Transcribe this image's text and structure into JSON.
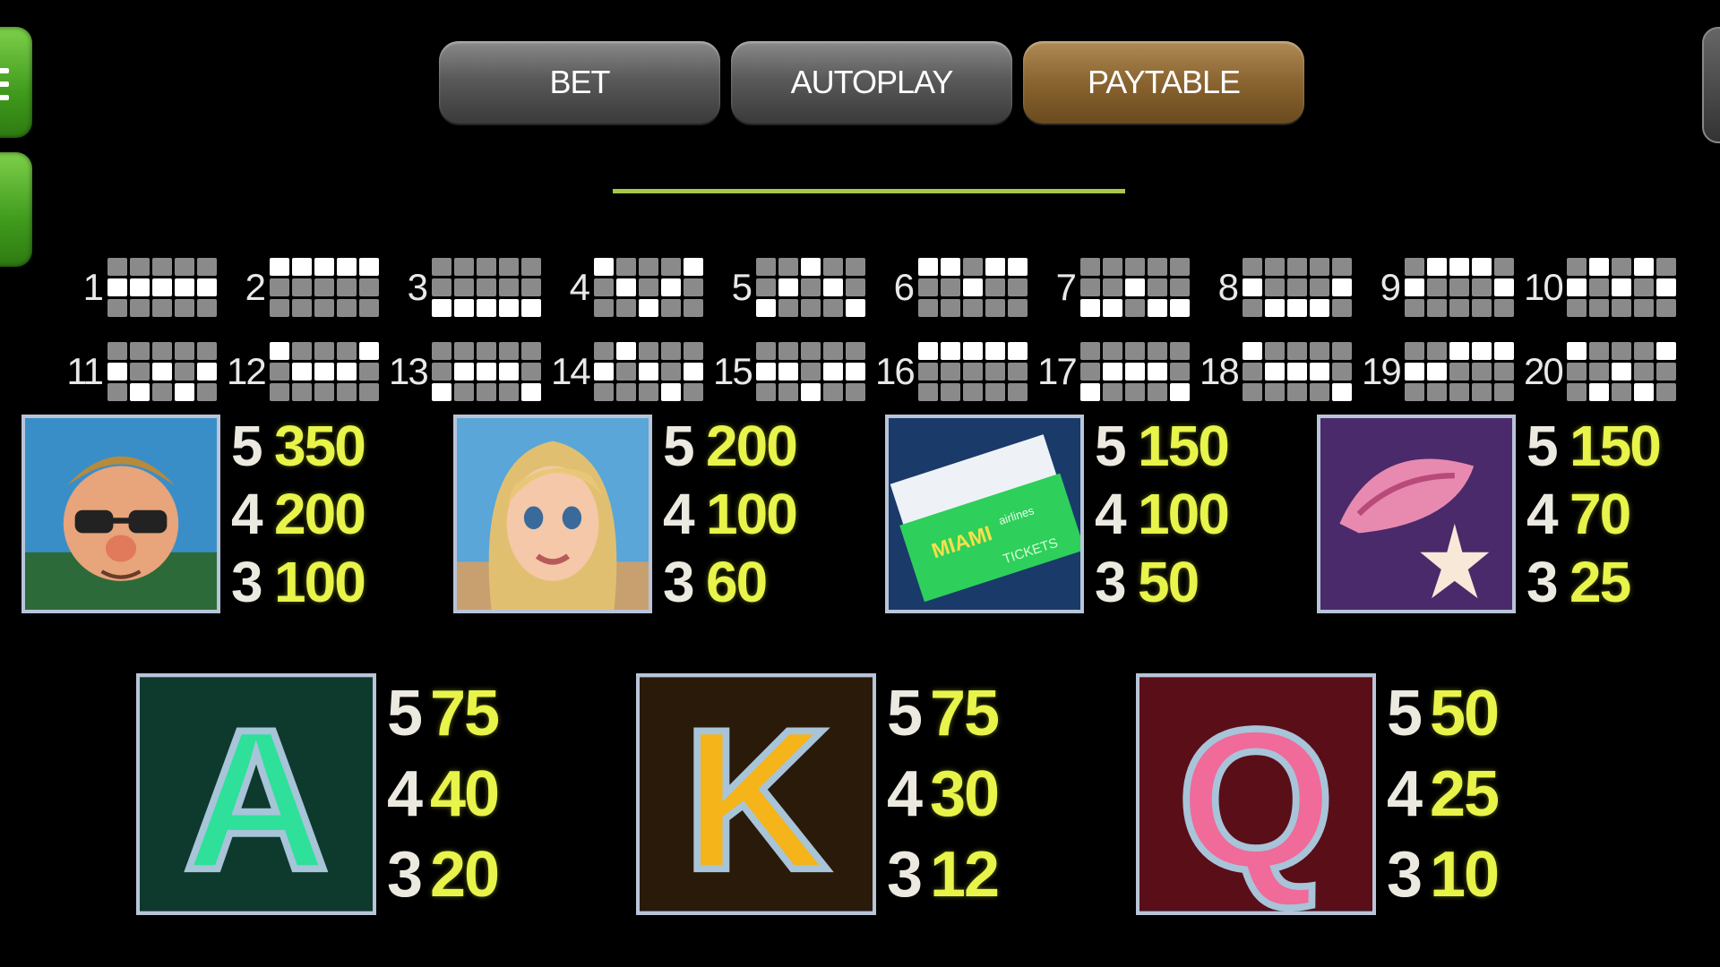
{
  "tabs": [
    {
      "label": "BET",
      "active": false
    },
    {
      "label": "AUTOPLAY",
      "active": false
    },
    {
      "label": "PAYTABLE",
      "active": true
    }
  ],
  "colors": {
    "accent_green": "#3f9a1c",
    "divider": "#a5c84a",
    "payout_value": "#e8f44a",
    "active_tab": "#8a6430"
  },
  "paylines": [
    {
      "number": "1",
      "pattern": [
        [
          0,
          0,
          0,
          0,
          0
        ],
        [
          1,
          1,
          1,
          1,
          1
        ],
        [
          0,
          0,
          0,
          0,
          0
        ]
      ]
    },
    {
      "number": "2",
      "pattern": [
        [
          1,
          1,
          1,
          1,
          1
        ],
        [
          0,
          0,
          0,
          0,
          0
        ],
        [
          0,
          0,
          0,
          0,
          0
        ]
      ]
    },
    {
      "number": "3",
      "pattern": [
        [
          0,
          0,
          0,
          0,
          0
        ],
        [
          0,
          0,
          0,
          0,
          0
        ],
        [
          1,
          1,
          1,
          1,
          1
        ]
      ]
    },
    {
      "number": "4",
      "pattern": [
        [
          1,
          0,
          0,
          0,
          1
        ],
        [
          0,
          1,
          0,
          1,
          0
        ],
        [
          0,
          0,
          1,
          0,
          0
        ]
      ]
    },
    {
      "number": "5",
      "pattern": [
        [
          0,
          0,
          1,
          0,
          0
        ],
        [
          0,
          1,
          0,
          1,
          0
        ],
        [
          1,
          0,
          0,
          0,
          1
        ]
      ]
    },
    {
      "number": "6",
      "pattern": [
        [
          1,
          1,
          0,
          1,
          1
        ],
        [
          0,
          0,
          1,
          0,
          0
        ],
        [
          0,
          0,
          0,
          0,
          0
        ]
      ]
    },
    {
      "number": "7",
      "pattern": [
        [
          0,
          0,
          0,
          0,
          0
        ],
        [
          0,
          0,
          1,
          0,
          0
        ],
        [
          1,
          1,
          0,
          1,
          1
        ]
      ]
    },
    {
      "number": "8",
      "pattern": [
        [
          0,
          0,
          0,
          0,
          0
        ],
        [
          1,
          0,
          0,
          0,
          1
        ],
        [
          0,
          1,
          1,
          1,
          0
        ]
      ]
    },
    {
      "number": "9",
      "pattern": [
        [
          0,
          1,
          1,
          1,
          0
        ],
        [
          1,
          0,
          0,
          0,
          1
        ],
        [
          0,
          0,
          0,
          0,
          0
        ]
      ]
    },
    {
      "number": "10",
      "pattern": [
        [
          0,
          1,
          0,
          1,
          0
        ],
        [
          1,
          0,
          1,
          0,
          1
        ],
        [
          0,
          0,
          0,
          0,
          0
        ]
      ]
    },
    {
      "number": "11",
      "pattern": [
        [
          0,
          0,
          0,
          0,
          0
        ],
        [
          1,
          0,
          1,
          0,
          1
        ],
        [
          0,
          1,
          0,
          1,
          0
        ]
      ]
    },
    {
      "number": "12",
      "pattern": [
        [
          1,
          0,
          0,
          0,
          1
        ],
        [
          0,
          1,
          1,
          1,
          0
        ],
        [
          0,
          0,
          0,
          0,
          0
        ]
      ]
    },
    {
      "number": "13",
      "pattern": [
        [
          0,
          0,
          0,
          0,
          0
        ],
        [
          0,
          1,
          1,
          1,
          0
        ],
        [
          1,
          0,
          0,
          0,
          1
        ]
      ]
    },
    {
      "number": "14",
      "pattern": [
        [
          0,
          1,
          0,
          0,
          0
        ],
        [
          1,
          0,
          1,
          0,
          1
        ],
        [
          0,
          0,
          0,
          1,
          0
        ]
      ]
    },
    {
      "number": "15",
      "pattern": [
        [
          0,
          0,
          0,
          0,
          0
        ],
        [
          1,
          1,
          0,
          1,
          1
        ],
        [
          0,
          0,
          1,
          0,
          0
        ]
      ]
    },
    {
      "number": "16",
      "pattern": [
        [
          1,
          1,
          1,
          1,
          1
        ],
        [
          0,
          0,
          0,
          0,
          0
        ],
        [
          0,
          0,
          0,
          0,
          0
        ]
      ]
    },
    {
      "number": "17",
      "pattern": [
        [
          0,
          0,
          0,
          0,
          0
        ],
        [
          0,
          1,
          1,
          1,
          0
        ],
        [
          1,
          0,
          0,
          0,
          1
        ]
      ]
    },
    {
      "number": "18",
      "pattern": [
        [
          1,
          0,
          0,
          0,
          0
        ],
        [
          0,
          1,
          1,
          1,
          0
        ],
        [
          0,
          0,
          0,
          0,
          1
        ]
      ]
    },
    {
      "number": "19",
      "pattern": [
        [
          0,
          0,
          1,
          1,
          1
        ],
        [
          1,
          1,
          0,
          0,
          0
        ],
        [
          0,
          0,
          0,
          0,
          0
        ]
      ]
    },
    {
      "number": "20",
      "pattern": [
        [
          1,
          0,
          0,
          0,
          1
        ],
        [
          0,
          0,
          1,
          0,
          0
        ],
        [
          0,
          1,
          0,
          1,
          0
        ]
      ]
    }
  ],
  "symbols_row1": [
    {
      "icon": "man-sunglasses-icon",
      "pays": [
        {
          "count": "5",
          "value": "350"
        },
        {
          "count": "4",
          "value": "200"
        },
        {
          "count": "3",
          "value": "100"
        }
      ]
    },
    {
      "icon": "blonde-woman-icon",
      "pays": [
        {
          "count": "5",
          "value": "200"
        },
        {
          "count": "4",
          "value": "100"
        },
        {
          "count": "3",
          "value": "60"
        }
      ]
    },
    {
      "icon": "plane-tickets-icon",
      "pays": [
        {
          "count": "5",
          "value": "150"
        },
        {
          "count": "4",
          "value": "100"
        },
        {
          "count": "3",
          "value": "50"
        }
      ]
    },
    {
      "icon": "seashell-starfish-icon",
      "pays": [
        {
          "count": "5",
          "value": "150"
        },
        {
          "count": "4",
          "value": "70"
        },
        {
          "count": "3",
          "value": "25"
        }
      ]
    }
  ],
  "symbols_row2": [
    {
      "icon": "letter-a-icon",
      "letter": "A",
      "pays": [
        {
          "count": "5",
          "value": "75"
        },
        {
          "count": "4",
          "value": "40"
        },
        {
          "count": "3",
          "value": "20"
        }
      ]
    },
    {
      "icon": "letter-k-icon",
      "letter": "K",
      "pays": [
        {
          "count": "5",
          "value": "75"
        },
        {
          "count": "4",
          "value": "30"
        },
        {
          "count": "3",
          "value": "12"
        }
      ]
    },
    {
      "icon": "letter-q-icon",
      "letter": "Q",
      "pays": [
        {
          "count": "5",
          "value": "50"
        },
        {
          "count": "4",
          "value": "25"
        },
        {
          "count": "3",
          "value": "10"
        }
      ]
    }
  ],
  "ticket_text": {
    "brand": "MIAMI",
    "sub": "airlines",
    "label": "TICKETS"
  }
}
